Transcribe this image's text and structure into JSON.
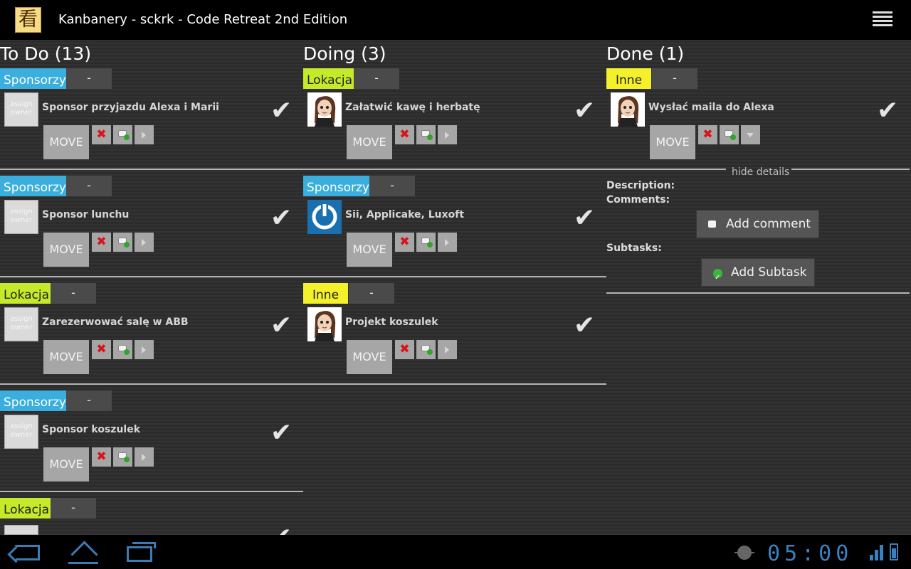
{
  "actionbar": {
    "app_icon_glyph": "看",
    "title": "Kanbanery - sckrk - Code Retreat 2nd Edition"
  },
  "columns": [
    {
      "title": "To Do (13)"
    },
    {
      "title": "Doing (3)"
    },
    {
      "title": "Done (1)"
    }
  ],
  "tasks": {
    "todo": [
      {
        "tag": "Sponsorzy",
        "tag_minus": "-",
        "avatar_text": "assign owner",
        "title": "Sponsor przyjazdu Alexa i Marii",
        "check": "✔",
        "move": "MOVE",
        "delete": "✖"
      },
      {
        "tag": "Sponsorzy",
        "tag_minus": "-",
        "avatar_text": "assign owner",
        "title": "Sponsor lunchu",
        "check": "✔",
        "move": "MOVE",
        "delete": "✖"
      },
      {
        "tag": "Lokacja",
        "tag_minus": "-",
        "avatar_text": "assign owner",
        "title": "Zarezerwować salę w ABB",
        "check": "✔",
        "move": "MOVE",
        "delete": "✖"
      },
      {
        "tag": "Sponsorzy",
        "tag_minus": "-",
        "avatar_text": "assign owner",
        "title": "Sponsor koszulek",
        "check": "✔",
        "move": "MOVE",
        "delete": "✖"
      },
      {
        "tag": "Lokacja",
        "tag_minus": "-",
        "check": "✔"
      }
    ],
    "doing": [
      {
        "tag": "Lokacja",
        "tag_minus": "-",
        "title": "Załatwić kawę i herbatę",
        "check": "✔",
        "move": "MOVE",
        "delete": "✖"
      },
      {
        "tag": "Sponsorzy",
        "tag_minus": "-",
        "title": "Sii, Applicake, Luxoft",
        "check": "✔",
        "move": "MOVE",
        "delete": "✖"
      },
      {
        "tag": "Inne",
        "tag_minus": "-",
        "title": "Projekt koszulek",
        "check": "✔",
        "move": "MOVE",
        "delete": "✖"
      }
    ],
    "done": [
      {
        "tag": "Inne",
        "tag_minus": "-",
        "title": "Wysłać maila do Alexa",
        "check": "✔",
        "move": "MOVE",
        "delete": "✖"
      }
    ]
  },
  "details": {
    "hide_label": "hide details",
    "description_label": "Description:",
    "comments_label": "Comments:",
    "add_comment": "Add comment",
    "subtasks_label": "Subtasks:",
    "add_subtask": "Add Subtask"
  },
  "status_bar": {
    "time": "05:00"
  },
  "colors": {
    "board_background": "#2e2e2e",
    "tag_sponsorzy": "#3aaedc",
    "tag_lokacja": "#c4ea29",
    "tag_inne": "#f4f12a",
    "system_accent": "#3a80c0"
  },
  "icons": [
    "app-icon",
    "overflow-menu-icon",
    "avatar-icon",
    "checkmark-icon",
    "delete-icon",
    "comment-icon",
    "expand-icon",
    "back-icon",
    "home-icon",
    "recent-apps-icon",
    "debug-bug-icon",
    "signal-icon",
    "battery-icon"
  ]
}
